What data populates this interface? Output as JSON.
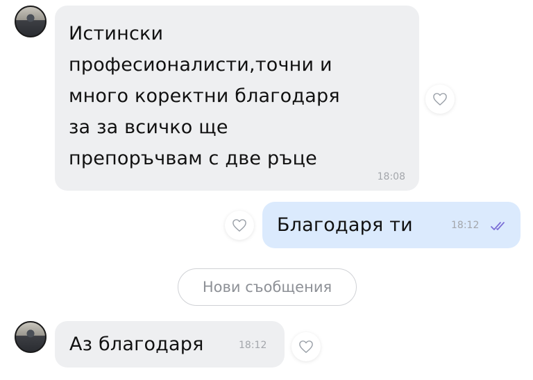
{
  "messages": [
    {
      "direction": "incoming",
      "text": "Истински\nпрофесионалисти,точни и\nмного коректни благодаря\nза за всичко ще\nпрепоръчвам с две ръце",
      "time": "18:08",
      "icon": "heart-outline-icon"
    },
    {
      "direction": "outgoing",
      "text": "Благодаря ти",
      "time": "18:12",
      "status": "double-check-read-icon",
      "icon": "heart-outline-icon"
    },
    {
      "direction": "incoming",
      "text": "Аз благодаря",
      "time": "18:12",
      "icon": "heart-outline-icon"
    }
  ],
  "divider": {
    "label": "Нови съобщения"
  },
  "colors": {
    "incoming_bubble": "#eeeff1",
    "outgoing_bubble": "#dbeafd",
    "read_check": "#7b6fd6",
    "time": "#a3a6ab"
  }
}
